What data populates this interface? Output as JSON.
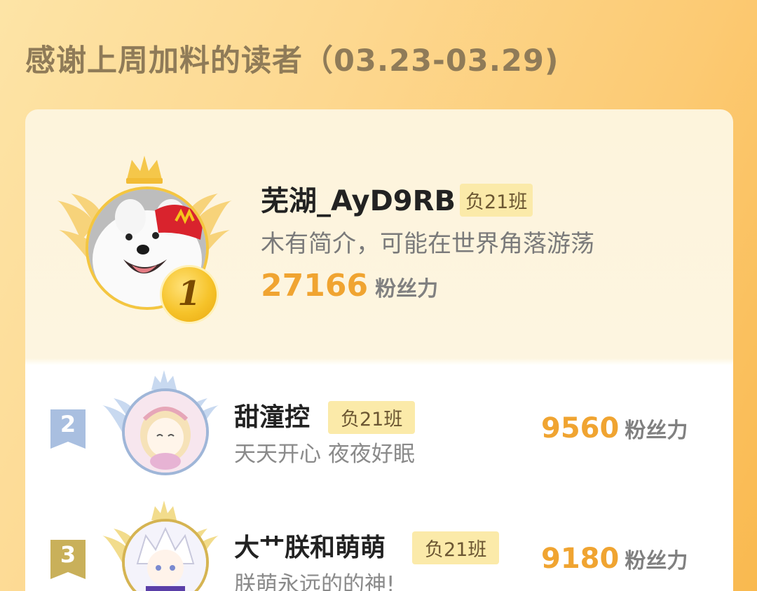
{
  "page": {
    "title": "感谢上周加料的读者（03.23-03.29)"
  },
  "colors": {
    "accent": "#f0a431",
    "tag_bg": "#fbeaa9",
    "gold": "#f5c42c",
    "silver": "#a9bfe0",
    "bronze": "#c9b05a"
  },
  "leaderboard": [
    {
      "rank": "1",
      "name": "芜湖_AyD9RB",
      "tag": "负21班",
      "bio": "木有简介，可能在世界角落游荡",
      "score": "27166",
      "unit": "粉丝力",
      "avatar_icon": "samoyed-dog-avatar"
    },
    {
      "rank": "2",
      "name": "甜潼控",
      "tag": "负21班",
      "bio": "天天开心 夜夜好眠",
      "score": "9560",
      "unit": "粉丝力",
      "avatar_icon": "anime-girl-avatar"
    },
    {
      "rank": "3",
      "name": "大艹朕和萌萌",
      "tag": "负21班",
      "bio": "朕萌永远的的神!",
      "score": "9180",
      "unit": "粉丝力",
      "avatar_icon": "anime-boy-avatar"
    }
  ]
}
